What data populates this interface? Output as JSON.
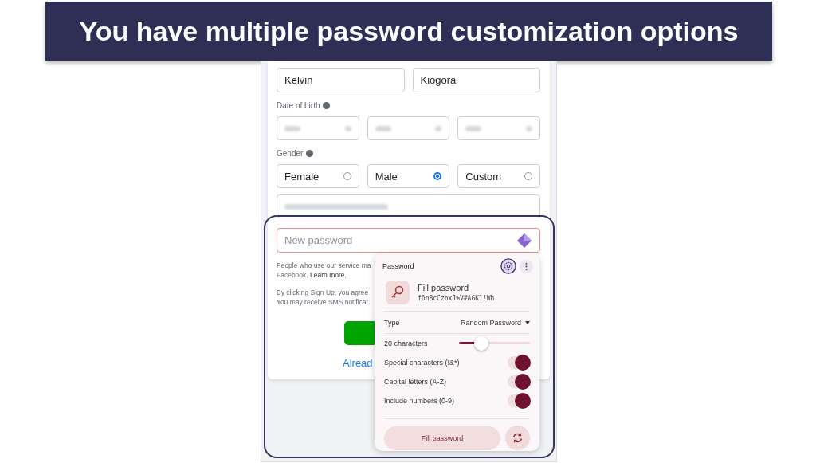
{
  "banner": {
    "title": "You have multiple password customization options"
  },
  "form": {
    "first_name": "Kelvin",
    "last_name": "Kiogora",
    "dob_label": "Date of birth",
    "gender_label": "Gender",
    "genders": [
      {
        "label": "Female",
        "selected": false
      },
      {
        "label": "Male",
        "selected": true
      },
      {
        "label": "Custom",
        "selected": false
      }
    ],
    "password_placeholder": "New password",
    "notice_1": "People who use our service ma",
    "notice_2_start": "Facebook.",
    "notice_2_link": "Learn more.",
    "terms_1": "By clicking Sign Up, you agree",
    "terms_2": "You may receive SMS notificat",
    "login_link": "Alread"
  },
  "popup": {
    "title": "Password",
    "fill_title": "Fill password",
    "generated": "f6n8cCzbxJ%V#AGK1!Wh",
    "type_label": "Type",
    "type_value": "Random Password",
    "length_label": "20 characters",
    "length_slider": {
      "level": 0.27
    },
    "options": [
      {
        "label": "Special characters (!&*)",
        "on": true
      },
      {
        "label": "Capital letters (A-Z)",
        "on": true
      },
      {
        "label": "Include numbers (0-9)",
        "on": true
      }
    ],
    "fill_button": "Fill password"
  }
}
